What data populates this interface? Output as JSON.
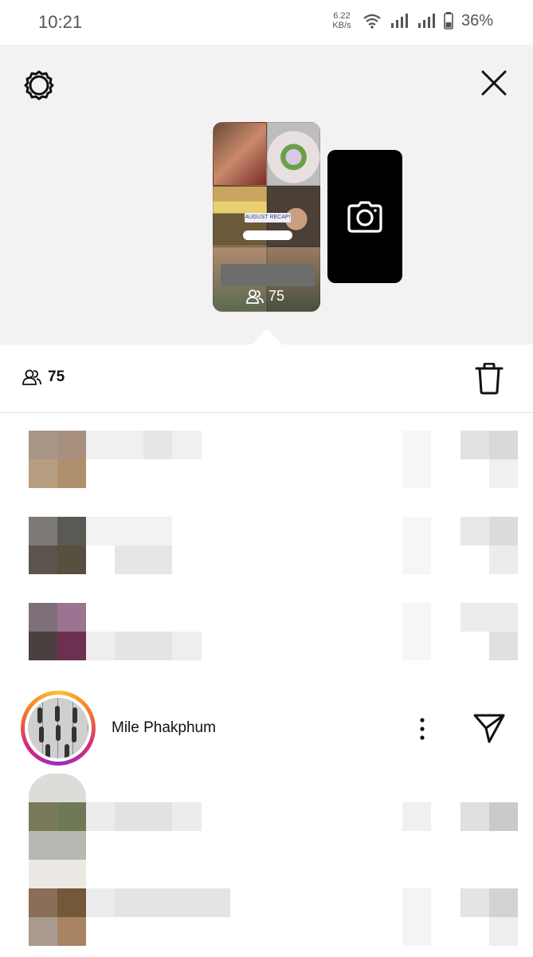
{
  "status_bar": {
    "time": "10:21",
    "net_speed_value": "6.22",
    "net_speed_unit": "KB/s",
    "battery_percent": "36%"
  },
  "story": {
    "recap_text": "AUGUST RECAP!",
    "viewer_count_overlay": "75"
  },
  "viewers": {
    "count": "75",
    "items": [
      {
        "username": "Mile Phakphum"
      }
    ]
  },
  "icons": {
    "settings": "gear-icon",
    "close": "close-icon",
    "camera": "camera-icon",
    "viewers": "people-icon",
    "delete": "trash-icon",
    "more": "more-vertical-icon",
    "send": "send-icon"
  },
  "colors": {
    "top_background": "#f2f2f2",
    "camera_card": "#000000",
    "story_ring_start": "#f7c430",
    "story_ring_end": "#962fbf"
  }
}
